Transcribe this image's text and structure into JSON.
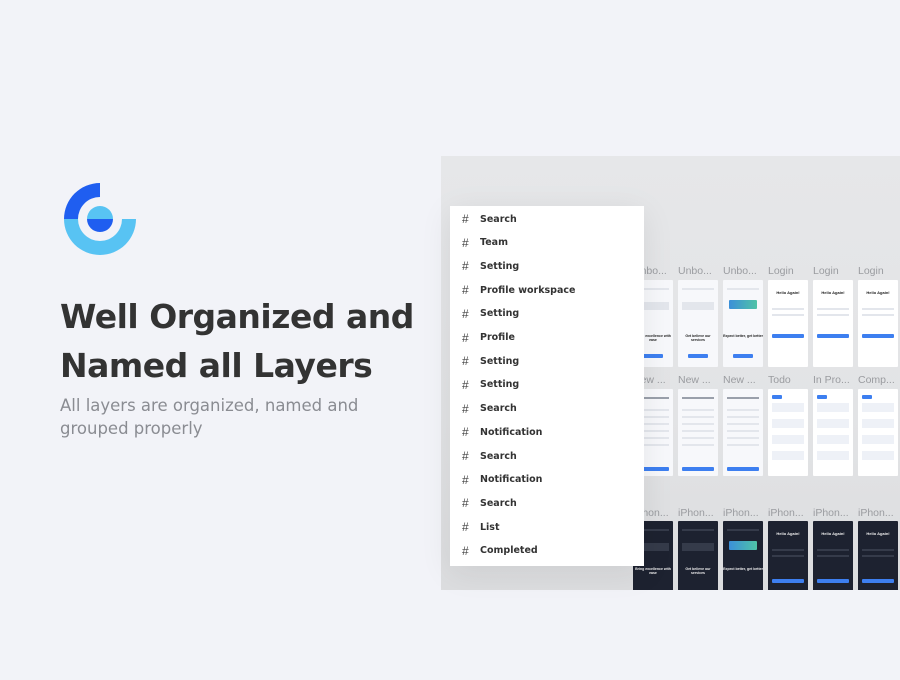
{
  "hero": {
    "title_line1": "Well Organized and",
    "title_line2": "Named all Layers",
    "subtitle": "All layers are organized, named and grouped properly"
  },
  "colors": {
    "brand_dark": "#1f5ef0",
    "brand_light": "#58c3f3",
    "accent": "#3d7ff0",
    "background": "#f2f3f8"
  },
  "layers": [
    {
      "icon": "hash-icon",
      "label": "Search"
    },
    {
      "icon": "hash-icon",
      "label": "Team"
    },
    {
      "icon": "hash-icon",
      "label": "Setting"
    },
    {
      "icon": "hash-icon",
      "label": "Profile workspace"
    },
    {
      "icon": "hash-icon",
      "label": "Setting"
    },
    {
      "icon": "hash-icon",
      "label": "Profile"
    },
    {
      "icon": "hash-icon",
      "label": "Setting"
    },
    {
      "icon": "hash-icon",
      "label": "Setting"
    },
    {
      "icon": "hash-icon",
      "label": "Search"
    },
    {
      "icon": "hash-icon",
      "label": "Notification"
    },
    {
      "icon": "hash-icon",
      "label": "Search"
    },
    {
      "icon": "hash-icon",
      "label": "Notification"
    },
    {
      "icon": "hash-icon",
      "label": "Search"
    },
    {
      "icon": "hash-icon",
      "label": "List"
    },
    {
      "icon": "hash-icon",
      "label": "Completed"
    }
  ],
  "frames": [
    [
      "Unbo...",
      "Unbo...",
      "Unbo...",
      "Login",
      "Login",
      "Login"
    ],
    [
      "New ...",
      "New ...",
      "New ...",
      "Todo",
      "In Pro...",
      "Comp..."
    ],
    [
      "iPhon...",
      "iPhon...",
      "iPhon...",
      "iPhon...",
      "iPhon...",
      "iPhon..."
    ]
  ],
  "frame_text": {
    "login_heading": "Hello Again!",
    "onboard1": "Bring excellence with ease",
    "onboard2": "Get believe our services",
    "onboard3": "Expect better, get better",
    "new_workspace": "Create a new workspace"
  }
}
